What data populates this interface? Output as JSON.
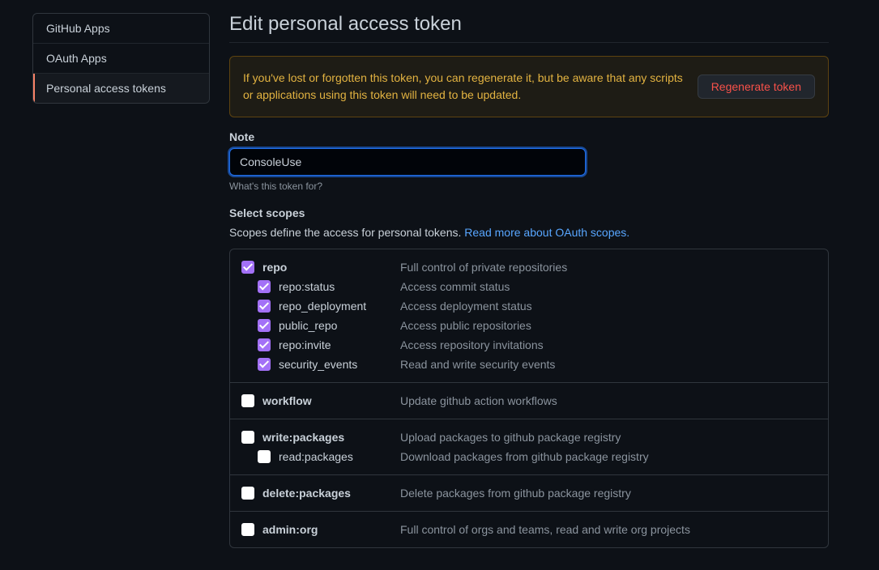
{
  "sidebar": {
    "items": [
      {
        "label": "GitHub Apps",
        "selected": false
      },
      {
        "label": "OAuth Apps",
        "selected": false
      },
      {
        "label": "Personal access tokens",
        "selected": true
      }
    ]
  },
  "page": {
    "title": "Edit personal access token"
  },
  "flash": {
    "text": "If you've lost or forgotten this token, you can regenerate it, but be aware that any scripts or applications using this token will need to be updated.",
    "button": "Regenerate token"
  },
  "note": {
    "label": "Note",
    "value": "ConsoleUse",
    "hint": "What's this token for?"
  },
  "scopes": {
    "label": "Select scopes",
    "desc": "Scopes define the access for personal tokens. ",
    "link": "Read more about OAuth scopes.",
    "groups": [
      {
        "name": "repo",
        "desc": "Full control of private repositories",
        "checked": true,
        "children": [
          {
            "name": "repo:status",
            "desc": "Access commit status",
            "checked": true
          },
          {
            "name": "repo_deployment",
            "desc": "Access deployment status",
            "checked": true
          },
          {
            "name": "public_repo",
            "desc": "Access public repositories",
            "checked": true
          },
          {
            "name": "repo:invite",
            "desc": "Access repository invitations",
            "checked": true
          },
          {
            "name": "security_events",
            "desc": "Read and write security events",
            "checked": true
          }
        ]
      },
      {
        "name": "workflow",
        "desc": "Update github action workflows",
        "checked": false,
        "children": []
      },
      {
        "name": "write:packages",
        "desc": "Upload packages to github package registry",
        "checked": false,
        "children": [
          {
            "name": "read:packages",
            "desc": "Download packages from github package registry",
            "checked": false
          }
        ]
      },
      {
        "name": "delete:packages",
        "desc": "Delete packages from github package registry",
        "checked": false,
        "children": []
      },
      {
        "name": "admin:org",
        "desc": "Full control of orgs and teams, read and write org projects",
        "checked": false,
        "children": []
      }
    ]
  }
}
